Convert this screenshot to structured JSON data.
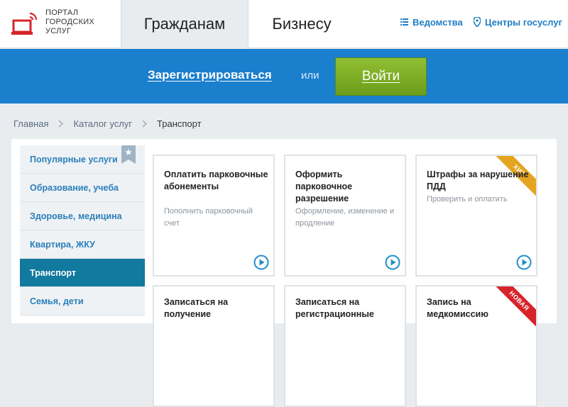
{
  "logo": {
    "lines": [
      "ПОРТАЛ",
      "ГОРОДСКИХ",
      "УСЛУГ"
    ]
  },
  "nav": {
    "tabs": [
      {
        "label": "Гражданам",
        "active": true
      },
      {
        "label": "Бизнесу",
        "active": false
      }
    ]
  },
  "header_links": {
    "departments": "Ведомства",
    "service_centers": "Центры госуслуг"
  },
  "auth": {
    "register": "Зарегистрироваться",
    "or": "или",
    "login": "Войти"
  },
  "breadcrumb": {
    "items": [
      "Главная",
      "Каталог услуг"
    ],
    "current": "Транспорт"
  },
  "sidebar": {
    "items": [
      {
        "label": "Популярные услуги",
        "active": false,
        "bookmarked": true
      },
      {
        "label": "Образование, учеба",
        "active": false
      },
      {
        "label": "Здоровье, медицина",
        "active": false
      },
      {
        "label": "Квартира, ЖКУ",
        "active": false
      },
      {
        "label": "Транспорт",
        "active": true
      },
      {
        "label": "Семья, дети",
        "active": false
      }
    ]
  },
  "cards": [
    {
      "title": "Оплатить парковочные абонементы",
      "description": "Пополнить парковочный счет",
      "badge": ""
    },
    {
      "title": "Оформить парковочное разрешение",
      "description": "Оформление, изменение и продление",
      "badge": ""
    },
    {
      "title": "Штрафы за нарушение ПДД",
      "description": "Проверить и оплатить",
      "badge": "ХИТ"
    },
    {
      "title": "Записаться на получение",
      "description": "",
      "badge": ""
    },
    {
      "title": "Записаться на регистрационные",
      "description": "",
      "badge": ""
    },
    {
      "title": "Запись на медкомиссию",
      "description": "",
      "badge": "НОВАЯ"
    }
  ],
  "colors": {
    "brand_blue": "#1a7fcd",
    "link_blue": "#1f7ec4",
    "login_green": "#7aaa22",
    "active_sidebar": "#12799f",
    "badge_hit": "#e4a41f",
    "badge_new": "#d7242b"
  },
  "icons": {
    "logo": "laptop-wifi-icon",
    "departments": "list-icon",
    "service_centers": "map-pin-icon",
    "breadcrumb_separator": "chevron-right-icon",
    "card_action": "play-circle-icon",
    "bookmark": "star-bookmark-icon"
  }
}
